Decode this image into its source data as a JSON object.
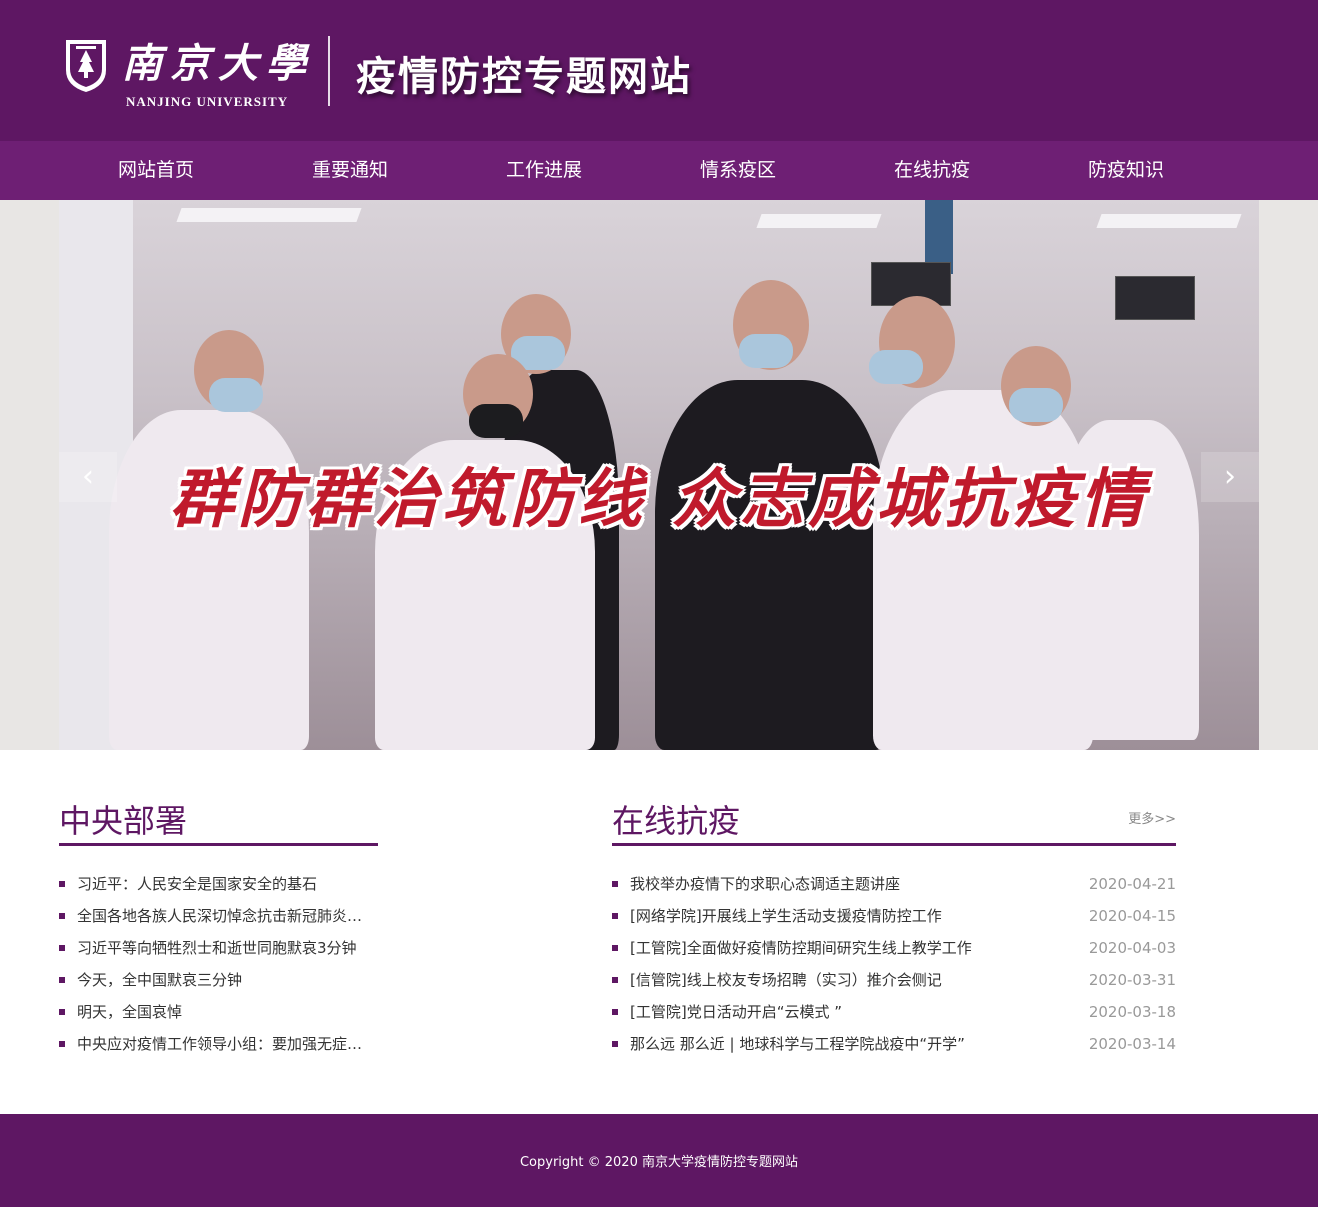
{
  "header": {
    "university_cn": "南京大學",
    "university_en": "NANJING UNIVERSITY",
    "site_title": "疫情防控专题网站",
    "logo_icon": "university-seal-icon"
  },
  "nav": {
    "items": [
      {
        "label": "网站首页"
      },
      {
        "label": "重要通知"
      },
      {
        "label": "工作进展"
      },
      {
        "label": "情系疫区"
      },
      {
        "label": "在线抗疫"
      },
      {
        "label": "防疫知识"
      }
    ]
  },
  "banner": {
    "slogan": "群防群治筑防线 众志成城抗疫情",
    "prev_icon": "chevron-left-icon",
    "next_icon": "chevron-right-icon"
  },
  "central": {
    "title": "中央部署",
    "items": [
      {
        "text": "习近平：人民安全是国家安全的基石"
      },
      {
        "text": "全国各地各族人民深切悼念抗击新冠肺炎疫情斗争牺牲烈士和逝世同胞"
      },
      {
        "text": "习近平等向牺牲烈士和逝世同胞默哀3分钟"
      },
      {
        "text": "今天，全中国默哀三分钟"
      },
      {
        "text": "明天，全国哀悼"
      },
      {
        "text": "中央应对疫情工作领导小组：要加强无症状感染者监测"
      }
    ]
  },
  "online": {
    "title": "在线抗疫",
    "more": "更多>>",
    "items": [
      {
        "text": "我校举办疫情下的求职心态调适主题讲座",
        "date": "2020-04-21"
      },
      {
        "text": "[网络学院]开展线上学生活动支援疫情防控工作",
        "date": "2020-04-15"
      },
      {
        "text": "[工管院]全面做好疫情防控期间研究生线上教学工作",
        "date": "2020-04-03"
      },
      {
        "text": "[信管院]线上校友专场招聘（实习）推介会侧记",
        "date": "2020-03-31"
      },
      {
        "text": "[工管院]党日活动开启“云模式 ”",
        "date": "2020-03-18"
      },
      {
        "text": "那么远 那么近 | 地球科学与工程学院战疫中“开学”",
        "date": "2020-03-14"
      }
    ]
  },
  "footer": {
    "copyright": "Copyright © 2020 南京大学疫情防控专题网站"
  },
  "colors": {
    "brand_purple": "#5e1763",
    "nav_purple": "#6e1f74",
    "slogan_red": "#c01a2c"
  }
}
